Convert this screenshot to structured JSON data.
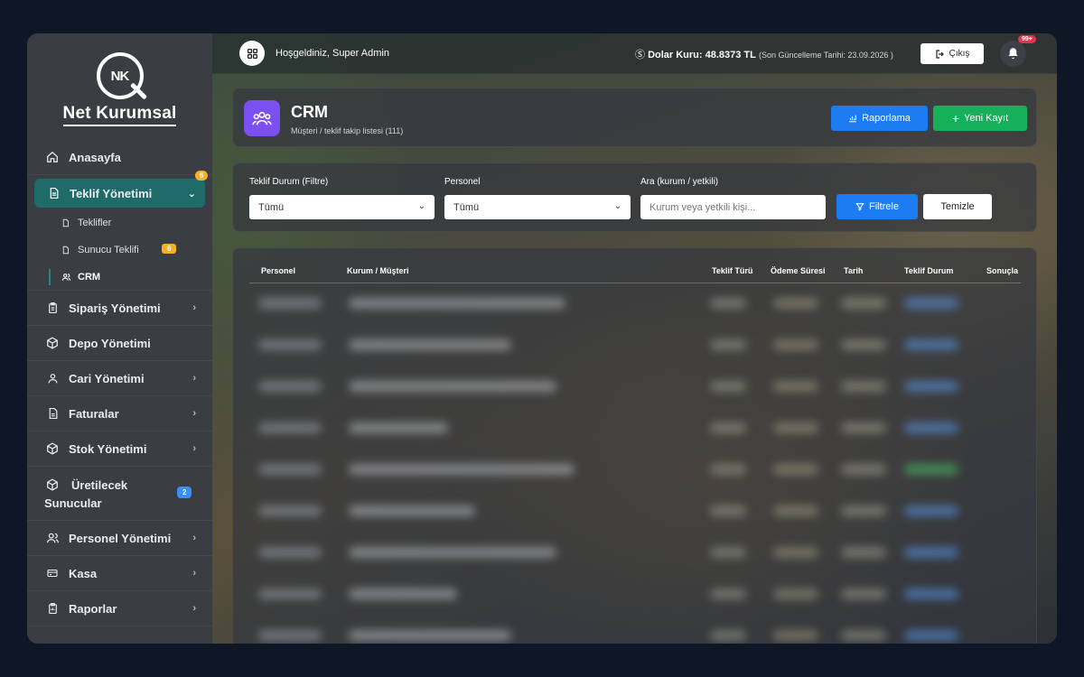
{
  "brand": {
    "monogram": "NK",
    "name": "Net Kurumsal"
  },
  "sidebar": {
    "home": "Anasayfa",
    "offer_mgmt": {
      "label": "Teklif Yönetimi",
      "badge": "6"
    },
    "sub": {
      "offers": "Teklifler",
      "server_offer": {
        "label": "Sunucu Teklifi",
        "badge": "6"
      },
      "crm": "CRM"
    },
    "order_mgmt": "Sipariş Yönetimi",
    "warehouse": "Depo Yönetimi",
    "account_mgmt": "Cari Yönetimi",
    "invoices": "Faturalar",
    "stock_mgmt": "Stok Yönetimi",
    "produced_servers": {
      "label_line1": "Üretilecek",
      "label_line2": "Sunucular",
      "badge": "2"
    },
    "personnel": "Personel Yönetimi",
    "cash": "Kasa",
    "reports": "Raporlar"
  },
  "topbar": {
    "welcome": "Hoşgeldiniz, Super Admin",
    "rate_label": "Dolar Kuru: 48.8373 TL",
    "rate_updated": "(Son Güncelleme Tarihi: 23.09.2026 )",
    "exit": "Çıkış",
    "notif_badge": "99+"
  },
  "header": {
    "title": "CRM",
    "subtitle": "Müşteri / teklif takip listesi (111)",
    "report_btn": "Raporlama",
    "new_btn": "Yeni Kayıt"
  },
  "filters": {
    "status_label": "Teklif Durum (Filtre)",
    "status_value": "Tümü",
    "personnel_label": "Personel",
    "personnel_value": "Tümü",
    "search_label": "Ara (kurum / yetkili)",
    "search_placeholder": "Kurum veya yetkili kişi...",
    "filter_btn": "Filtrele",
    "clear_btn": "Temizle"
  },
  "table": {
    "headers": [
      "Personel",
      "Kurum / Müşteri",
      "Teklif Türü",
      "Ödeme Süresi",
      "Tarih",
      "Teklif Durum",
      "Sonuçla"
    ]
  },
  "colors": {
    "accent_teal": "#1f6b6a",
    "primary": "#1d7cf2",
    "success": "#17b05a",
    "crm_icon": "#7b4ff0",
    "badge_yellow": "#f6b026",
    "badge_red": "#e0344a"
  }
}
